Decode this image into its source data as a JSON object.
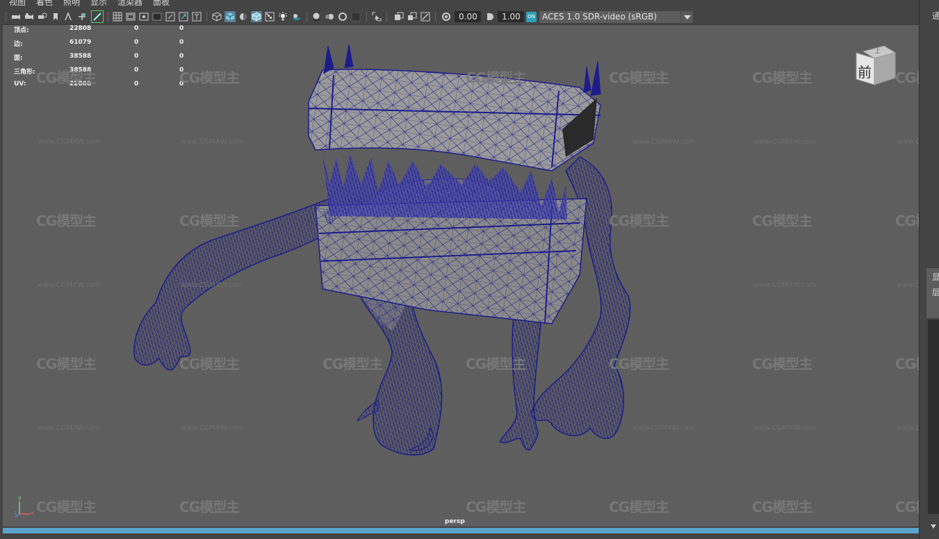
{
  "menu": [
    {
      "label": "视图"
    },
    {
      "label": "着色"
    },
    {
      "label": "照明"
    },
    {
      "label": "显示"
    },
    {
      "label": "渲染器"
    },
    {
      "label": "面板"
    }
  ],
  "toolbar": {
    "exposure_value": "0.00",
    "gamma_value": "1.00",
    "color_space": "ACES 1.0 SDR-video (sRGB)",
    "color_space_icon": "ON"
  },
  "hud": {
    "rows": [
      {
        "label": "顶点:",
        "v1": "22808",
        "v2": "0",
        "v3": "0"
      },
      {
        "label": "边:",
        "v1": "61079",
        "v2": "0",
        "v3": "0"
      },
      {
        "label": "面:",
        "v1": "38588",
        "v2": "0",
        "v3": "0"
      },
      {
        "label": "三角形:",
        "v1": "38588",
        "v2": "0",
        "v3": "0"
      },
      {
        "label": "UV:",
        "v1": "22808",
        "v2": "0",
        "v3": "0"
      }
    ]
  },
  "viewport": {
    "camera": "persp",
    "viewcube_top": "上",
    "viewcube_front": "前",
    "axis_x": "x",
    "axis_y": "y",
    "axis_z": "z",
    "watermark": "CG模型主",
    "watermark_url": "www.CGMXW.com",
    "wire_color": "#1c1c8c",
    "viewport_bg": "#5e5e5e"
  },
  "right_panel": {
    "top_text": "通",
    "mid_text_1": "显",
    "mid_text_2": "层"
  },
  "colors": {
    "accent": "#5aa4cc",
    "toolbar_active": "#5d7d95"
  }
}
